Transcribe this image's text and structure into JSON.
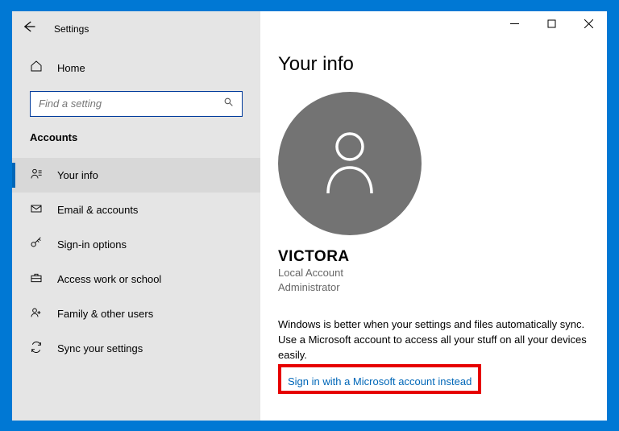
{
  "app": {
    "title": "Settings"
  },
  "home": {
    "label": "Home"
  },
  "search": {
    "placeholder": "Find a setting"
  },
  "section": {
    "header": "Accounts"
  },
  "nav": {
    "items": [
      {
        "label": "Your info"
      },
      {
        "label": "Email & accounts"
      },
      {
        "label": "Sign-in options"
      },
      {
        "label": "Access work or school"
      },
      {
        "label": "Family & other users"
      },
      {
        "label": "Sync your settings"
      }
    ]
  },
  "page": {
    "title": "Your info",
    "username": "VICTORA",
    "account_type": "Local Account",
    "role": "Administrator",
    "info_text": "Windows is better when your settings and files automatically sync. Use a Microsoft account to access all your stuff on all your devices easily.",
    "signin_link": "Sign in with a Microsoft account instead"
  }
}
